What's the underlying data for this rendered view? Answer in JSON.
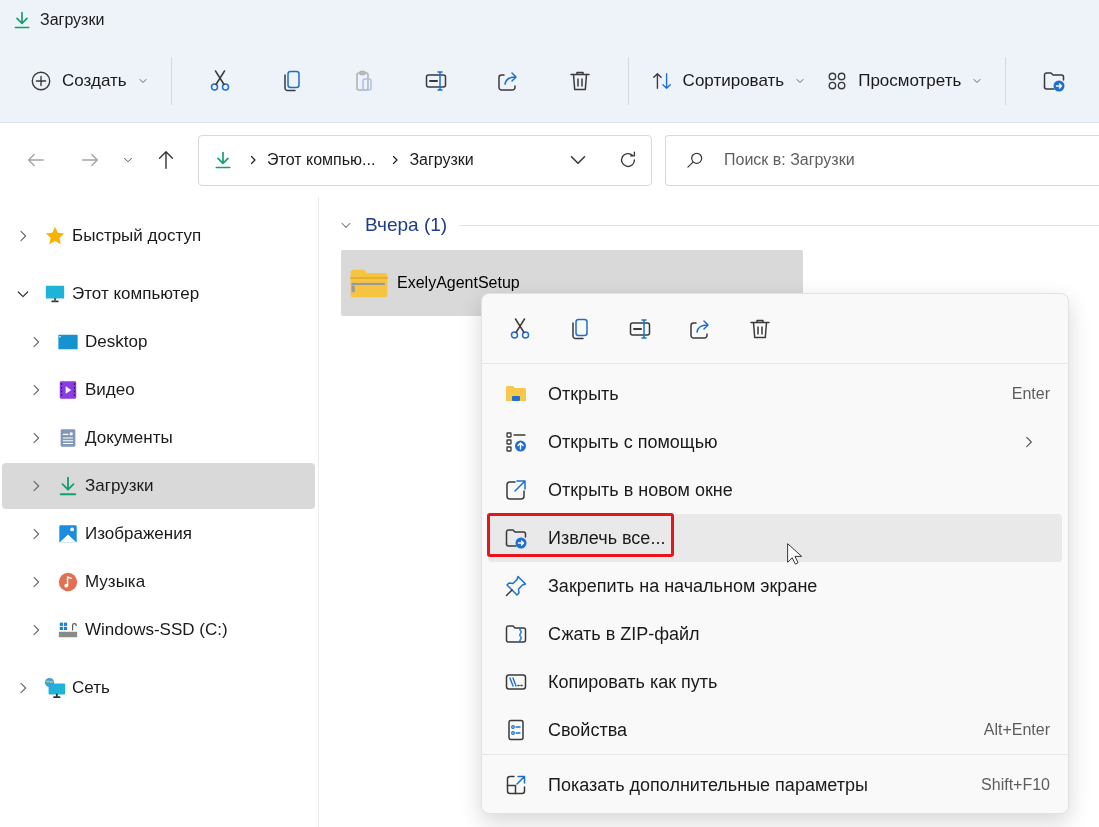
{
  "window": {
    "title": "Загрузки"
  },
  "toolbar": {
    "items": [
      {
        "kind": "menu",
        "label": "Создать"
      },
      {
        "kind": "separator"
      },
      {
        "kind": "icon",
        "disabled": false
      },
      {
        "kind": "icon",
        "disabled": false
      },
      {
        "kind": "icon",
        "disabled": true
      },
      {
        "kind": "icon",
        "disabled": false
      },
      {
        "kind": "icon",
        "disabled": false
      },
      {
        "kind": "icon",
        "disabled": false
      },
      {
        "kind": "separator"
      },
      {
        "kind": "menu",
        "label": "Сортировать"
      },
      {
        "kind": "menu",
        "label": "Просмотреть"
      },
      {
        "kind": "separator"
      },
      {
        "kind": "icon",
        "disabled": false
      }
    ]
  },
  "navigation": {
    "back": {
      "disabled": true
    },
    "forward": {
      "disabled": true
    },
    "up": {
      "disabled": false
    }
  },
  "address_bar": {
    "segments": [
      "Этот компью...",
      "Загрузки"
    ]
  },
  "search": {
    "placeholder": "Поиск в: Загрузки"
  },
  "sidebar": {
    "items": [
      {
        "label": "Быстрый доступ",
        "expanded": false,
        "selected": false
      },
      {
        "label": "Этот компьютер",
        "expanded": true,
        "selected": false,
        "children": [
          {
            "label": "Desktop",
            "expanded": false,
            "selected": false
          },
          {
            "label": "Видео",
            "expanded": false,
            "selected": false
          },
          {
            "label": "Документы",
            "expanded": false,
            "selected": false
          },
          {
            "label": "Загрузки",
            "expanded": false,
            "selected": true
          },
          {
            "label": "Изображения",
            "expanded": false,
            "selected": false
          },
          {
            "label": "Музыка",
            "expanded": false,
            "selected": false
          },
          {
            "label": "Windows-SSD (C:)",
            "expanded": false,
            "selected": false
          }
        ]
      },
      {
        "label": "Сеть",
        "expanded": false,
        "selected": false
      }
    ]
  },
  "content": {
    "groups": [
      {
        "title": "Вчера (1)",
        "expanded": true,
        "files": [
          {
            "name": "ExelyAgentSetup",
            "selected": true
          }
        ]
      }
    ]
  },
  "context_menu": {
    "sections": [
      [
        {
          "label": "Открыть",
          "shortcut": "Enter",
          "submenu": false,
          "hovered": false,
          "highlighted": false
        },
        {
          "label": "Открыть с помощью",
          "submenu": true,
          "hovered": false,
          "highlighted": false
        },
        {
          "label": "Открыть в новом окне",
          "submenu": false,
          "hovered": false,
          "highlighted": false
        },
        {
          "label": "Извлечь все...",
          "submenu": false,
          "hovered": true,
          "highlighted": true
        },
        {
          "label": "Закрепить на начальном экране",
          "submenu": false,
          "hovered": false,
          "highlighted": false
        },
        {
          "label": "Сжать в ZIP-файл",
          "submenu": false,
          "hovered": false,
          "highlighted": false
        },
        {
          "label": "Копировать как путь",
          "submenu": false,
          "hovered": false,
          "highlighted": false
        },
        {
          "label": "Свойства",
          "shortcut": "Alt+Enter",
          "submenu": false,
          "hovered": false,
          "highlighted": false
        }
      ],
      [
        {
          "label": "Показать дополнительные параметры",
          "shortcut": "Shift+F10",
          "submenu": false,
          "hovered": false,
          "highlighted": false
        }
      ]
    ]
  }
}
